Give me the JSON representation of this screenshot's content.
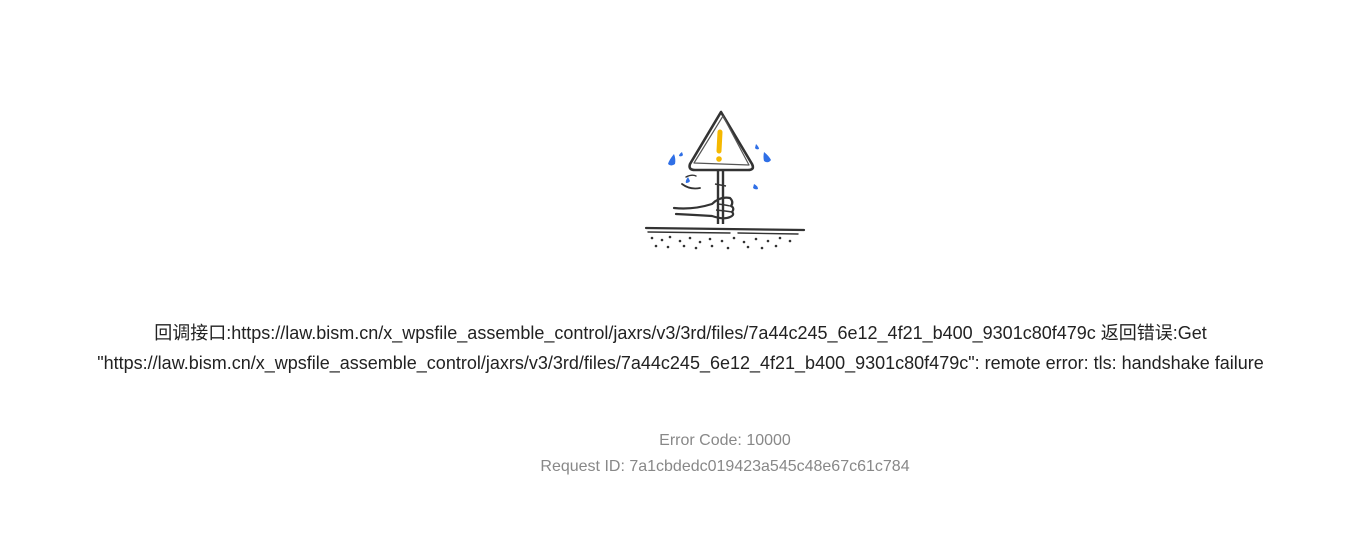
{
  "illustration": {
    "icon": "warning-sign-in-ground-icon",
    "accent_color": "#f5b800",
    "drop_color": "#2f6fe6"
  },
  "error": {
    "message_line1": "回调接口:https://law.bism.cn/x_wpsfile_assemble_control/jaxrs/v3/3rd/files/7a44c245_6e12_4f21_b400_9301c80f479c 返回错误:Get",
    "message_line2": "\"https://law.bism.cn/x_wpsfile_assemble_control/jaxrs/v3/3rd/files/7a44c245_6e12_4f21_b400_9301c80f479c\": remote error: tls: handshake failure",
    "error_code": "Error Code: 10000",
    "request_id": "Request ID: 7a1cbdedc019423a545c48e67c61c784"
  }
}
